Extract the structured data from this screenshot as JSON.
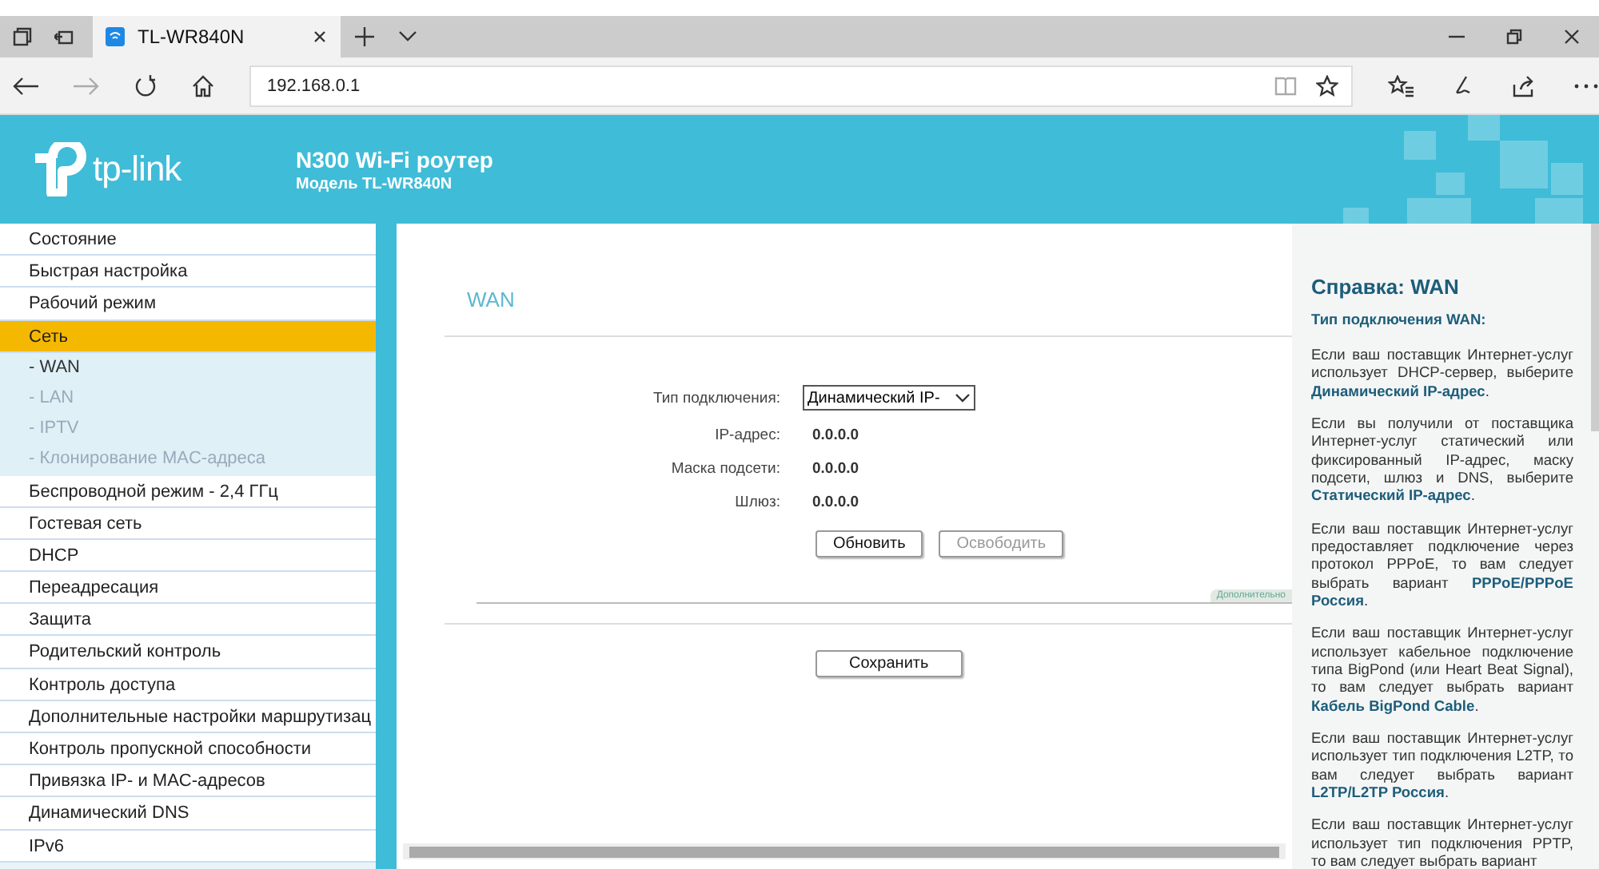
{
  "browser": {
    "tab_title": "TL-WR840N",
    "url": "192.168.0.1"
  },
  "header": {
    "logo_text": "tp-link",
    "title": "N300 Wi-Fi роутер",
    "model": "Модель TL-WR840N"
  },
  "sidebar": {
    "items": [
      {
        "label": "Состояние",
        "selected": false
      },
      {
        "label": "Быстрая настройка",
        "selected": false
      },
      {
        "label": "Рабочий режим",
        "selected": false
      },
      {
        "label": "Сеть",
        "selected": true,
        "expanded": true,
        "children": [
          {
            "label": "- WAN",
            "selected": true
          },
          {
            "label": "- LAN",
            "selected": false
          },
          {
            "label": "- IPTV",
            "selected": false
          },
          {
            "label": "- Клонирование MAC-адреса",
            "selected": false
          }
        ]
      },
      {
        "label": "Беспроводной режим - 2,4 ГГц",
        "selected": false
      },
      {
        "label": "Гостевая сеть",
        "selected": false
      },
      {
        "label": "DHCP",
        "selected": false
      },
      {
        "label": "Переадресация",
        "selected": false
      },
      {
        "label": "Защита",
        "selected": false
      },
      {
        "label": "Родительский контроль",
        "selected": false
      },
      {
        "label": "Контроль доступа",
        "selected": false
      },
      {
        "label": "Дополнительные настройки маршрутизац",
        "selected": false
      },
      {
        "label": "Контроль пропускной способности",
        "selected": false
      },
      {
        "label": "Привязка IP- и MAC-адресов",
        "selected": false
      },
      {
        "label": "Динамический DNS",
        "selected": false
      },
      {
        "label": "IPv6",
        "selected": false
      }
    ]
  },
  "main": {
    "title": "WAN",
    "fields": [
      {
        "kind": "select",
        "label": "Тип подключения:",
        "value": "Динамический IP-"
      },
      {
        "kind": "readout",
        "label": "IP-адрес:",
        "value": "0.0.0.0"
      },
      {
        "kind": "readout",
        "label": "Маска подсети:",
        "value": "0.0.0.0"
      },
      {
        "kind": "readout",
        "label": "Шлюз:",
        "value": "0.0.0.0"
      }
    ],
    "buttons": [
      {
        "label": "Обновить",
        "disabled": false
      },
      {
        "label": "Освободить",
        "disabled": true
      }
    ],
    "advanced_tab": "Дополнительно",
    "save_button": "Сохранить"
  },
  "help": {
    "title": "Справка: WAN",
    "subtitle": "Тип подключения WAN:",
    "paragraphs": [
      "Если ваш поставщик Интернет-услуг использует DHCP-сервер, выберите **Динамический IP-адрес**.",
      "Если вы получили от поставщика Интернет-услуг статический или фиксированный IP-адрес, маску подсети, шлюз и DNS, выберите **Статический IP-адрес**.",
      "Если ваш поставщик Интернет-услуг предоставляет подключение через протокол PPPoE, то вам следует выбрать вариант **PPPoE/PPPoE Россия**.",
      "Если ваш поставщик Интернет-услуг использует кабельное подключение типа BigPond (или Heart Beat Signal), то вам следует выбрать вариант **Кабель BigPond Cable**.",
      "Если ваш поставщик Интернет-услуг использует тип подключения L2TP, то вам следует выбрать вариант **L2TP/L2TP Россия**.",
      "Если ваш поставщик Интернет-услуг использует тип подключения PPTP, то вам следует выбрать вариант"
    ]
  }
}
